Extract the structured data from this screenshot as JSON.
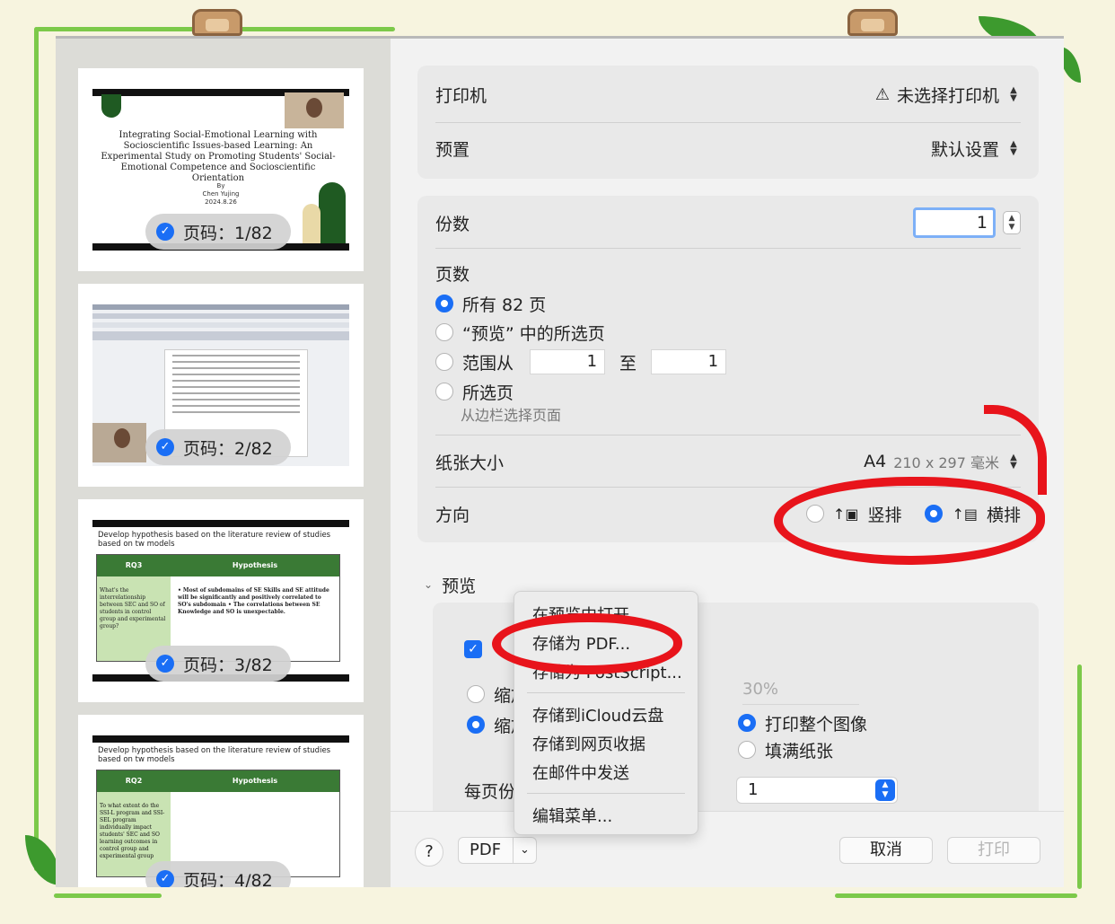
{
  "sidebar": {
    "pages": [
      {
        "badge": "页码：1/82",
        "title": "Integrating Social-Emotional Learning with Socioscientific Issues-based Learning: An Experimental Study on Promoting Students' Social-Emotional Competence and Socioscientific Orientation",
        "byline": "By",
        "author": "Chen Yujing",
        "date": "2024.8.26"
      },
      {
        "badge": "页码：2/82"
      },
      {
        "badge": "页码：3/82",
        "heading": "Develop hypothesis based on the literature review of studies based on tw models",
        "col1": "RQ3",
        "col2": "Hypothesis",
        "cell1": "What's the interrelationship between SEC and SO of students in control group and experimental group?",
        "cell2": "• Most of subdomains of SE Skills and SE attitude will be significantly and positively correlated to SO's subdomain • The correlations between SE Knowledge and SO is unexpectable."
      },
      {
        "badge": "页码：4/82",
        "heading": "Develop hypothesis based on the literature review of studies based on tw models",
        "col1": "RQ2",
        "col2": "Hypothesis",
        "cell1": "To what extent do the SSI-L program and SSI-SEL program individually impact students' SEC and SO learning outcomes in control group and experimental group"
      }
    ]
  },
  "printer": {
    "label": "打印机",
    "value": "未选择打印机"
  },
  "preset": {
    "label": "预置",
    "value": "默认设置"
  },
  "copies": {
    "label": "份数",
    "value": "1"
  },
  "pages": {
    "label": "页数",
    "options": [
      "所有 82 页",
      "“预览” 中的所选页",
      "范围从",
      "所选页"
    ],
    "range_to": "至",
    "range_from_value": "1",
    "range_to_value": "1",
    "selected_hint": "从边栏选择页面"
  },
  "paper": {
    "label": "纸张大小",
    "value": "A4",
    "dims": "210 x 297 毫米"
  },
  "orientation": {
    "label": "方向",
    "portrait": "竖排",
    "landscape": "横排"
  },
  "preview": {
    "label": "预览",
    "scale_a": "缩放",
    "scale_b": "缩放以适合",
    "scale_value": "30%",
    "fit_all": "打印整个图像",
    "fill_paper": "填满纸张",
    "per_page_label": "每页份数",
    "per_page_value": "1"
  },
  "menu": {
    "items": [
      "在预览中打开",
      "存储为 PDF...",
      "存储为 PostScript...",
      "存储到iCloud云盘",
      "存储到网页收据",
      "在邮件中发送",
      "编辑菜单..."
    ]
  },
  "footer": {
    "help": "?",
    "pdf": "PDF",
    "cancel": "取消",
    "print": "打印"
  }
}
